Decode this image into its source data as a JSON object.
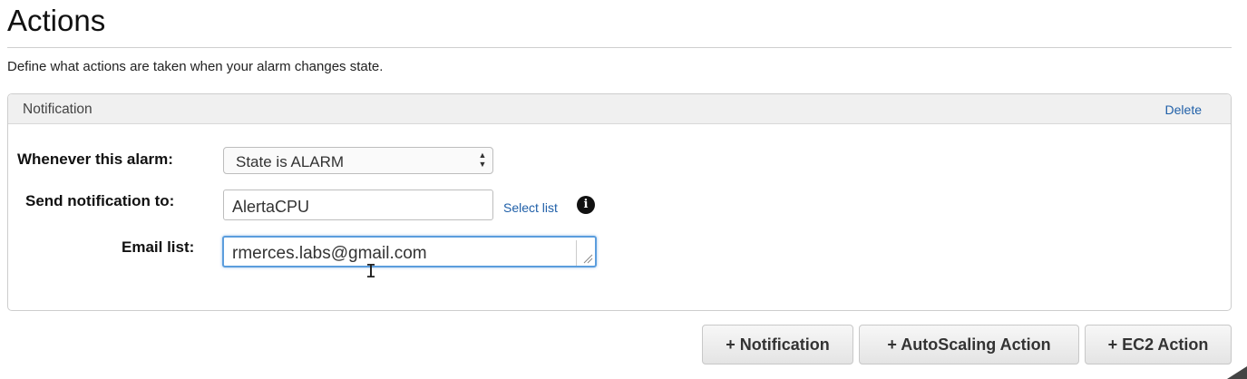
{
  "page": {
    "title": "Actions",
    "description": "Define what actions are taken when your alarm changes state."
  },
  "notification_panel": {
    "header": "Notification",
    "delete_label": "Delete",
    "whenever_label": "Whenever this alarm:",
    "state_value": "State is ALARM",
    "send_to_label": "Send notification to:",
    "send_to_value": "AlertaCPU",
    "select_list_label": "Select list",
    "info_icon": "i",
    "email_label": "Email list:",
    "email_value": "rmerces.labs@gmail.com"
  },
  "buttons": {
    "notification": "+ Notification",
    "autoscaling": "+ AutoScaling Action",
    "ec2": "+ EC2 Action"
  }
}
